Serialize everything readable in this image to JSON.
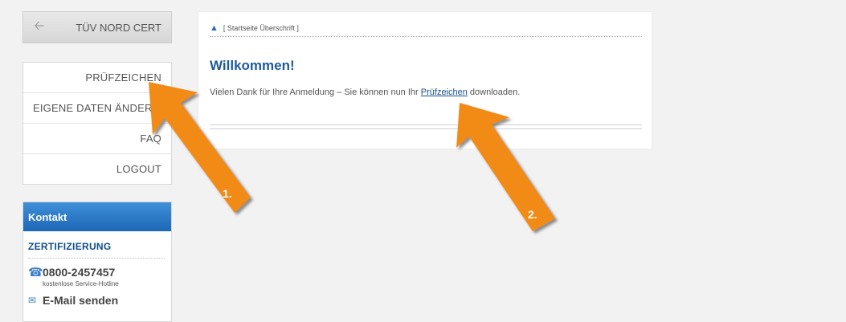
{
  "sidebar": {
    "back_label": "TÜV NORD CERT",
    "menu": [
      {
        "label": "PRÜFZEICHEN"
      },
      {
        "label": "EIGENE DATEN ÄNDERN"
      },
      {
        "label": "FAQ"
      },
      {
        "label": "LOGOUT"
      }
    ],
    "kontakt": {
      "title": "Kontakt",
      "section": "ZERTIFIZIERUNG",
      "phone": "0800-2457457",
      "hotline": "kostenlose Service-Hotline",
      "email": "E-Mail senden"
    }
  },
  "main": {
    "breadcrumb": "[ Startseite Überschrift ]",
    "title": "Willkommen!",
    "message_before": "Vielen Dank für Ihre Anmeldung – Sie können nun Ihr",
    "message_link": "Prüfzeichen",
    "message_after": "downloaden."
  },
  "annotations": {
    "arrow1_label": "1.",
    "arrow2_label": "2.",
    "arrow_color": "#f28a14"
  },
  "icons": {
    "back": "arrow-left-icon",
    "breadcrumb": "sitemap-icon",
    "phone": "phone-icon",
    "mail": "mail-icon"
  }
}
